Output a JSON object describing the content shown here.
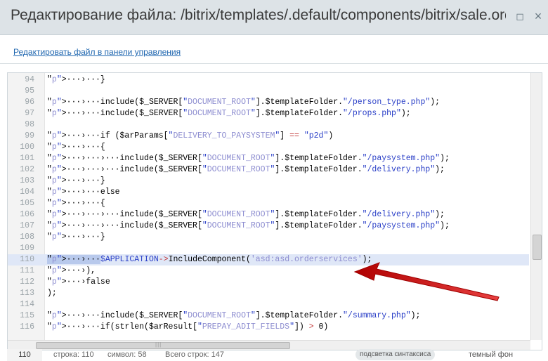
{
  "window": {
    "title": "Редактирование файла: /bitrix/templates/.default/components/bitrix/sale.order.a"
  },
  "edit_link": "Редактировать файл в панели управления",
  "code_lines": [
    {
      "n": "94",
      "t": "···›···}"
    },
    {
      "n": "95",
      "t": ""
    },
    {
      "n": "96",
      "t": "···›···include($_SERVER[\"DOCUMENT_ROOT\"].$templateFolder.\"/person_type.php\");"
    },
    {
      "n": "97",
      "t": "···›···include($_SERVER[\"DOCUMENT_ROOT\"].$templateFolder.\"/props.php\");"
    },
    {
      "n": "98",
      "t": ""
    },
    {
      "n": "99",
      "t": "···›···if ($arParams[\"DELIVERY_TO_PAYSYSTEM\"] == \"p2d\")"
    },
    {
      "n": "100",
      "t": "···›···{"
    },
    {
      "n": "101",
      "t": "···›···›···include($_SERVER[\"DOCUMENT_ROOT\"].$templateFolder.\"/paysystem.php\");"
    },
    {
      "n": "102",
      "t": "···›···›···include($_SERVER[\"DOCUMENT_ROOT\"].$templateFolder.\"/delivery.php\");"
    },
    {
      "n": "103",
      "t": "···›···}"
    },
    {
      "n": "104",
      "t": "···›···else"
    },
    {
      "n": "105",
      "t": "···›···{"
    },
    {
      "n": "106",
      "t": "···›···›···include($_SERVER[\"DOCUMENT_ROOT\"].$templateFolder.\"/delivery.php\");"
    },
    {
      "n": "107",
      "t": "···›···›···include($_SERVER[\"DOCUMENT_ROOT\"].$templateFolder.\"/paysystem.php\");"
    },
    {
      "n": "108",
      "t": "···›···}"
    },
    {
      "n": "109",
      "t": ""
    },
    {
      "n": "110",
      "t": "···›···$APPLICATION->IncludeComponent('asd:asd.orderservices');"
    },
    {
      "n": "111",
      "t": "···›),"
    },
    {
      "n": "112",
      "t": "···›false"
    },
    {
      "n": "113",
      "t": ");"
    },
    {
      "n": "114",
      "t": ""
    },
    {
      "n": "115",
      "t": "···›···include($_SERVER[\"DOCUMENT_ROOT\"].$templateFolder.\"/summary.php\");"
    },
    {
      "n": "116",
      "t": "···›···if(strlen($arResult[\"PREPAY_ADIT_FIELDS\"]) > 0)"
    }
  ],
  "highlighted_line": "110",
  "status": {
    "line_number": "110",
    "row": "строка: 110",
    "col": "символ: 58",
    "total": "Всего строк: 147",
    "syntax_button": "подсветка синтаксиса",
    "dark_bg": "темный фон"
  },
  "colors": {
    "accent_arrow": "#d21f1f",
    "highlight": "#dfe7f7",
    "link": "#2067b0"
  }
}
